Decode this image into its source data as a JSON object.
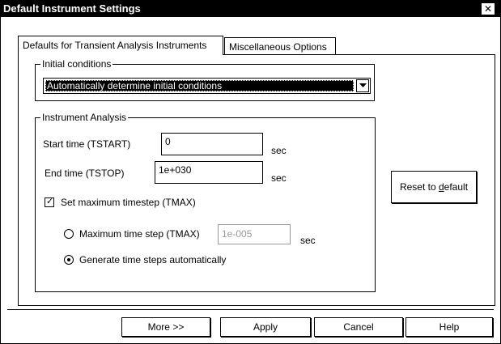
{
  "window": {
    "title": "Default Instrument Settings",
    "close_glyph": "✕"
  },
  "tabs": [
    {
      "label": "Defaults for Transient Analysis Instruments",
      "active": true
    },
    {
      "label": "Miscellaneous Options",
      "active": false
    }
  ],
  "initial_conditions": {
    "group_label": "Initial conditions",
    "selected": "Automatically determine initial conditions"
  },
  "instrument_analysis": {
    "group_label": "Instrument Analysis",
    "start_time": {
      "label": "Start time (TSTART)",
      "value": "0",
      "unit": "sec"
    },
    "end_time": {
      "label": "End time (TSTOP)",
      "value": "1e+030",
      "unit": "sec"
    },
    "set_max_timestep": {
      "label": "Set maximum timestep (TMAX)",
      "checked": true,
      "check_glyph": "✓"
    },
    "max_time_step": {
      "label": "Maximum time step (TMAX)",
      "value": "1e-005",
      "unit": "sec",
      "selected": false,
      "enabled": false
    },
    "generate_auto": {
      "label": "Generate time steps automatically",
      "selected": true
    }
  },
  "reset_button": {
    "label": "Reset to default"
  },
  "footer": {
    "more_label": "More >>",
    "apply_label": "Apply",
    "cancel_label": "Cancel",
    "help_label": "Help"
  }
}
